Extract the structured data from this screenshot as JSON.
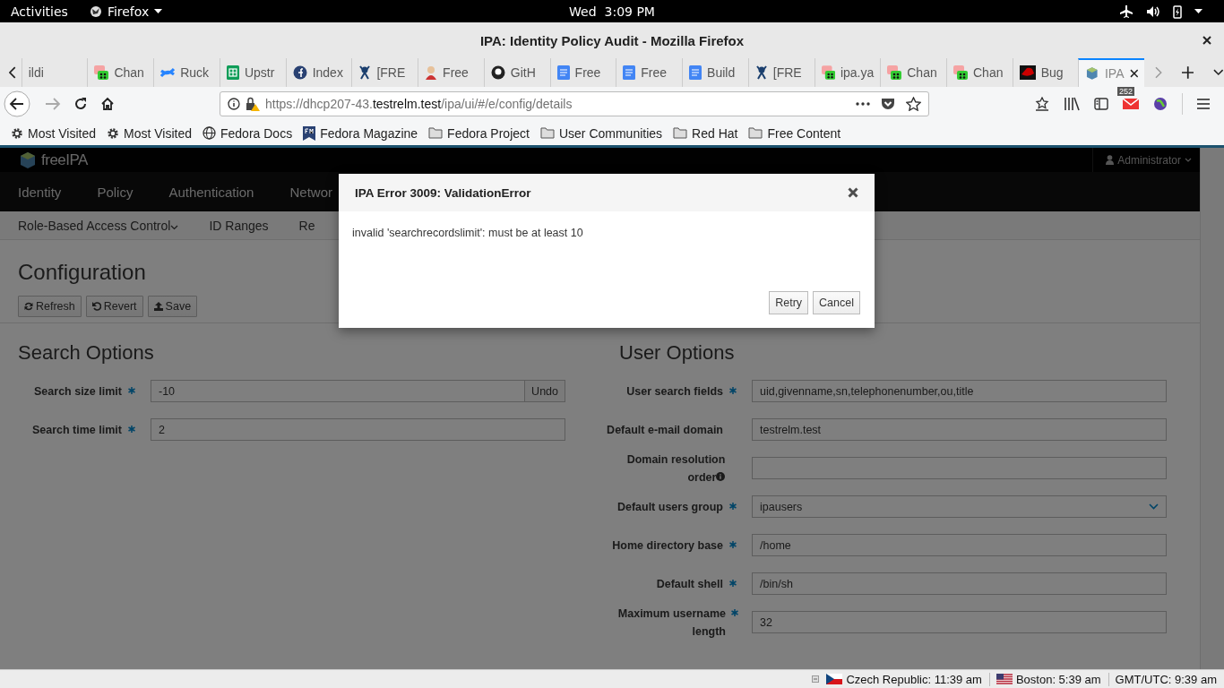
{
  "top_bar": {
    "activities": "Activities",
    "app_menu": "Firefox",
    "clock": "Wed  3:09 PM"
  },
  "window": {
    "title": "IPA: Identity Policy Audit - Mozilla Firefox"
  },
  "tabs": [
    {
      "label": "ildi",
      "kind": "blank",
      "selected": false
    },
    {
      "label": "Chan",
      "kind": "gerrit",
      "selected": false
    },
    {
      "label": "Ruck",
      "kind": "confluence",
      "selected": false
    },
    {
      "label": "Upstr",
      "kind": "sheet",
      "selected": false
    },
    {
      "label": "Index",
      "kind": "fedora",
      "selected": false
    },
    {
      "label": "[FRE",
      "kind": "jenkins",
      "selected": false
    },
    {
      "label": "Free",
      "kind": "person",
      "selected": false
    },
    {
      "label": "GitH",
      "kind": "github",
      "selected": false
    },
    {
      "label": "Free",
      "kind": "doc",
      "selected": false
    },
    {
      "label": "Free",
      "kind": "doc",
      "selected": false
    },
    {
      "label": "Build",
      "kind": "doc",
      "selected": false
    },
    {
      "label": "[FRE",
      "kind": "jenkins",
      "selected": false
    },
    {
      "label": "ipa.ya",
      "kind": "gerrit",
      "selected": false
    },
    {
      "label": "Chan",
      "kind": "gerrit",
      "selected": false
    },
    {
      "label": "Chan",
      "kind": "gerrit",
      "selected": false
    },
    {
      "label": "Bug",
      "kind": "redhat",
      "selected": false
    },
    {
      "label": "IPA",
      "kind": "freeipa",
      "selected": true
    }
  ],
  "url": {
    "prefix": "https://dhcp207-43.",
    "domain": "testrelm.test",
    "path": "/ipa/ui/#/e/config/details"
  },
  "mail_badge": "252",
  "bookmarks": [
    {
      "label": "Most Visited",
      "kind": "gear"
    },
    {
      "label": "Most Visited",
      "kind": "gear"
    },
    {
      "label": "Fedora Docs",
      "kind": "globe"
    },
    {
      "label": "Fedora Magazine",
      "kind": "magazine"
    },
    {
      "label": "Fedora Project",
      "kind": "folder"
    },
    {
      "label": "User Communities",
      "kind": "folder"
    },
    {
      "label": "Red Hat",
      "kind": "folder"
    },
    {
      "label": "Free Content",
      "kind": "folder"
    }
  ],
  "header": {
    "brand": "freeIPA",
    "user": "Administrator"
  },
  "nav": [
    "Identity",
    "Policy",
    "Authentication",
    "Networ"
  ],
  "subnav": [
    {
      "label": "Role-Based Access Control",
      "dropdown": true
    },
    {
      "label": "ID Ranges",
      "dropdown": false
    },
    {
      "label": "Re",
      "dropdown": false
    }
  ],
  "page": {
    "title": "Configuration",
    "actions": [
      {
        "label": "Refresh",
        "kind": "refresh"
      },
      {
        "label": "Revert",
        "kind": "revert"
      },
      {
        "label": "Save",
        "kind": "save"
      }
    ]
  },
  "sections": [
    {
      "title": "Search Options",
      "fields": [
        {
          "label": "Search size limit",
          "required": true,
          "kind": "text",
          "value": "-10",
          "undo": "Undo"
        },
        {
          "label": "Search time limit",
          "required": true,
          "kind": "text",
          "value": "2"
        }
      ]
    },
    {
      "title": "User Options",
      "fields": [
        {
          "label": "User search fields",
          "required": true,
          "kind": "text",
          "value": "uid,givenname,sn,telephonenumber,ou,title"
        },
        {
          "label": "Default e-mail domain",
          "required": false,
          "kind": "text",
          "value": "testrelm.test"
        },
        {
          "label": "Domain resolution order",
          "required": false,
          "info": true,
          "kind": "text"
        },
        {
          "label": "Default users group",
          "required": true,
          "kind": "select",
          "value": "ipausers"
        },
        {
          "label": "Home directory base",
          "required": true,
          "kind": "text",
          "value": "/home"
        },
        {
          "label": "Default shell",
          "required": true,
          "kind": "text",
          "value": "/bin/sh"
        },
        {
          "label": "Maximum username length",
          "required": true,
          "kind": "text",
          "value": "32"
        }
      ]
    }
  ],
  "dialog": {
    "title": "IPA Error 3009: ValidationError",
    "message": "invalid 'searchrecordslimit': must be at least 10",
    "buttons": [
      "Retry",
      "Cancel"
    ]
  },
  "status_bar": [
    {
      "label": "Czech Republic: 11:39 am",
      "kind": "cz"
    },
    {
      "label": "Boston: 5:39 am",
      "kind": "us"
    },
    {
      "label": "GMT/UTC: 9:39 am",
      "kind": "none"
    }
  ]
}
